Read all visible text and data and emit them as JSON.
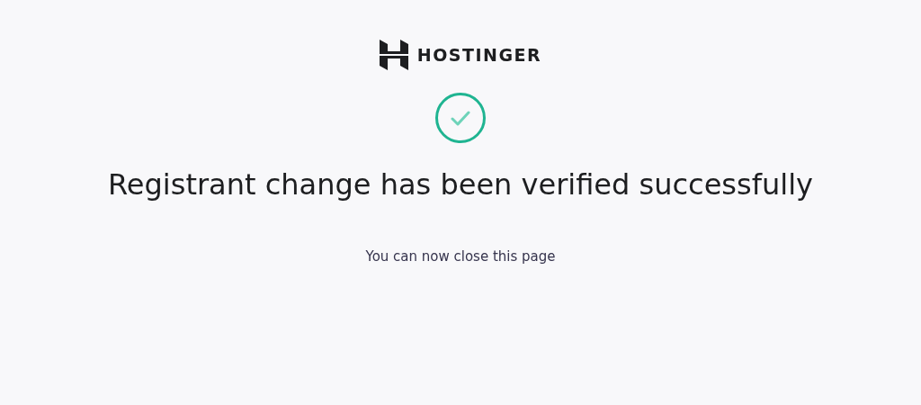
{
  "logo": {
    "text": "HOSTINGER"
  },
  "heading": "Registrant change has been verified successfully",
  "message": "You can now close this page"
}
